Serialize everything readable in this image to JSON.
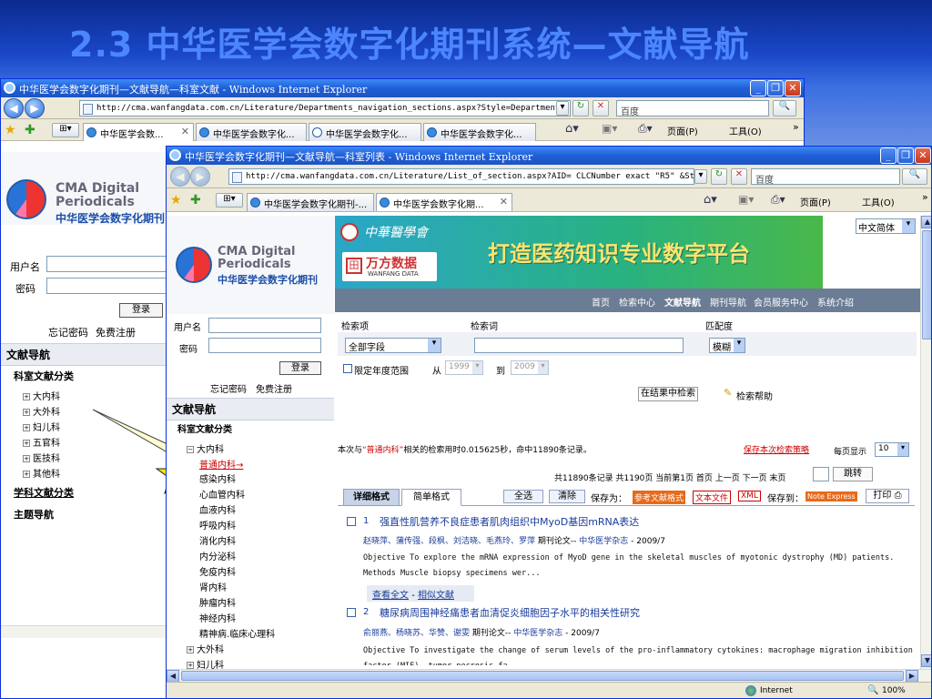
{
  "slide": {
    "title": "2.3 中华医学会数字化期刊系统—文献导航"
  },
  "back_window": {
    "title": "中华医学会数字化期刊—文献导航—科室文献 - Windows Internet Explorer",
    "address": "http://cma.wanfangdata.com.cn/Literature/Departments_navigation_sections.aspx?Style=Departments",
    "search_placeholder": "百度",
    "tabs": [
      "中华医学会数...",
      "中华医学会数字化...",
      "中华医学会数字化...",
      "中华医学会数字化..."
    ],
    "commands": {
      "page": "页面(P)",
      "tools": "工具(O)"
    }
  },
  "front_window": {
    "title": "中华医学会数字化期刊—文献导航—科室列表 - Windows Internet Explorer",
    "address": "http://cma.wanfangdata.com.cn/Literature/List_of_section.aspx?AID= CLCNumber exact \"R5\" &Style=Depar",
    "search_placeholder": "百度",
    "tabs": [
      "中华医学会数字化期刊-...",
      "中华医学会数字化期..."
    ],
    "commands": {
      "page": "页面(P)",
      "tools": "工具(O)"
    }
  },
  "logo": {
    "line1": "CMA Digital",
    "line2": "Periodicals",
    "line3": "中华医学会数字化期刊"
  },
  "login": {
    "user_label": "用户名",
    "password_label": "密码",
    "login_button": "登录",
    "forgot": "忘记密码",
    "register": "免费注册"
  },
  "nav": {
    "heading": "文献导航",
    "dept_heading": "科室文献分类",
    "subject_heading": "学科文献分类",
    "theme_heading": "主题导航",
    "back_tree": [
      "大内科",
      "大外科",
      "妇儿科",
      "五官科",
      "医技科",
      "其他科"
    ],
    "front_tree_root": "大内科",
    "front_tree_children": [
      "普通内科→",
      "感染内科",
      "心血管内科",
      "血液内科",
      "呼吸内科",
      "消化内科",
      "内分泌科",
      "免疫内科",
      "肾内科",
      "肿瘤内科",
      "神经内科",
      "精神病.临床心理科"
    ],
    "front_tree_more": [
      "大外科",
      "妇儿科"
    ]
  },
  "banner": {
    "logo_text": "中華醫學會",
    "wanfang": "万方数据",
    "wanfang_en": "WANFANG DATA",
    "slogan": "打造医药知识专业数字平台",
    "lang": "中文简体"
  },
  "topnav": [
    "首页",
    "检索中心",
    "文献导航",
    "期刊导航",
    "会员服务中心",
    "系统介绍"
  ],
  "search": {
    "col_item": "检索项",
    "col_word": "检索词",
    "col_match": "匹配度",
    "field_value": "全部字段",
    "match_value": "模糊",
    "year_limit": "限定年度范围",
    "from": "从",
    "to": "到",
    "year_from": "1999",
    "year_to": "2009",
    "in_results": "在结果中检索",
    "help": "检索帮助"
  },
  "results": {
    "summary_pre": "本次与",
    "summary_term": "“普通内科”",
    "summary_post": "相关的检索用时0.015625秒，命中11890条记录。",
    "save_link": "保存本次检索策略",
    "per_page_label": "每页显示",
    "per_page": "10",
    "pager": "共11890条记录 共1190页 当前第1页 首页 上一页  下一页 末页",
    "jump": "跳转",
    "tab_detail": "详细格式",
    "tab_simple": "简单格式",
    "select_all": "全选",
    "clear": "清除",
    "save_as": "保存为：",
    "fmt_ref": "参考文献格式",
    "fmt_text": "文本文件",
    "fmt_xml": "XML",
    "save_to": "保存到：",
    "note_express": "Note Express",
    "print": "打印",
    "items": [
      {
        "num": "1",
        "title": "强直性肌营养不良症患者肌肉组织中MyoD基因mRNA表达",
        "authors": "赵晓萍、蒲传强、段枫、刘洁晓、毛燕玲、罗萍",
        "type": "期刊论文--",
        "journal": "中华医学杂志",
        "year": "- 2009/7",
        "abstract": "Objective To explore the mRNA expression of MyoD gene in the skeletal muscles of myotonic dystrophy (MD) patients. Methods Muscle biopsy specimens wer...",
        "fulltext": "查看全文",
        "similar": "相似文献"
      },
      {
        "num": "2",
        "title": "糖尿病周围神经痛患者血清促炎细胞因子水平的相关性研究",
        "authors": "俞丽燕、杨晓苏、华赞、谢雯",
        "type": "期刊论文--",
        "journal": "中华医学杂志",
        "year": "- 2009/7",
        "abstract": "Objective To investigate the change of serum levels of the pro-inflammatory cytokines: macrophage migration inhibition factor (MIF), tumor necrosis fa..."
      }
    ]
  },
  "statusbar": {
    "zone": "Internet",
    "zoom": "100%"
  }
}
